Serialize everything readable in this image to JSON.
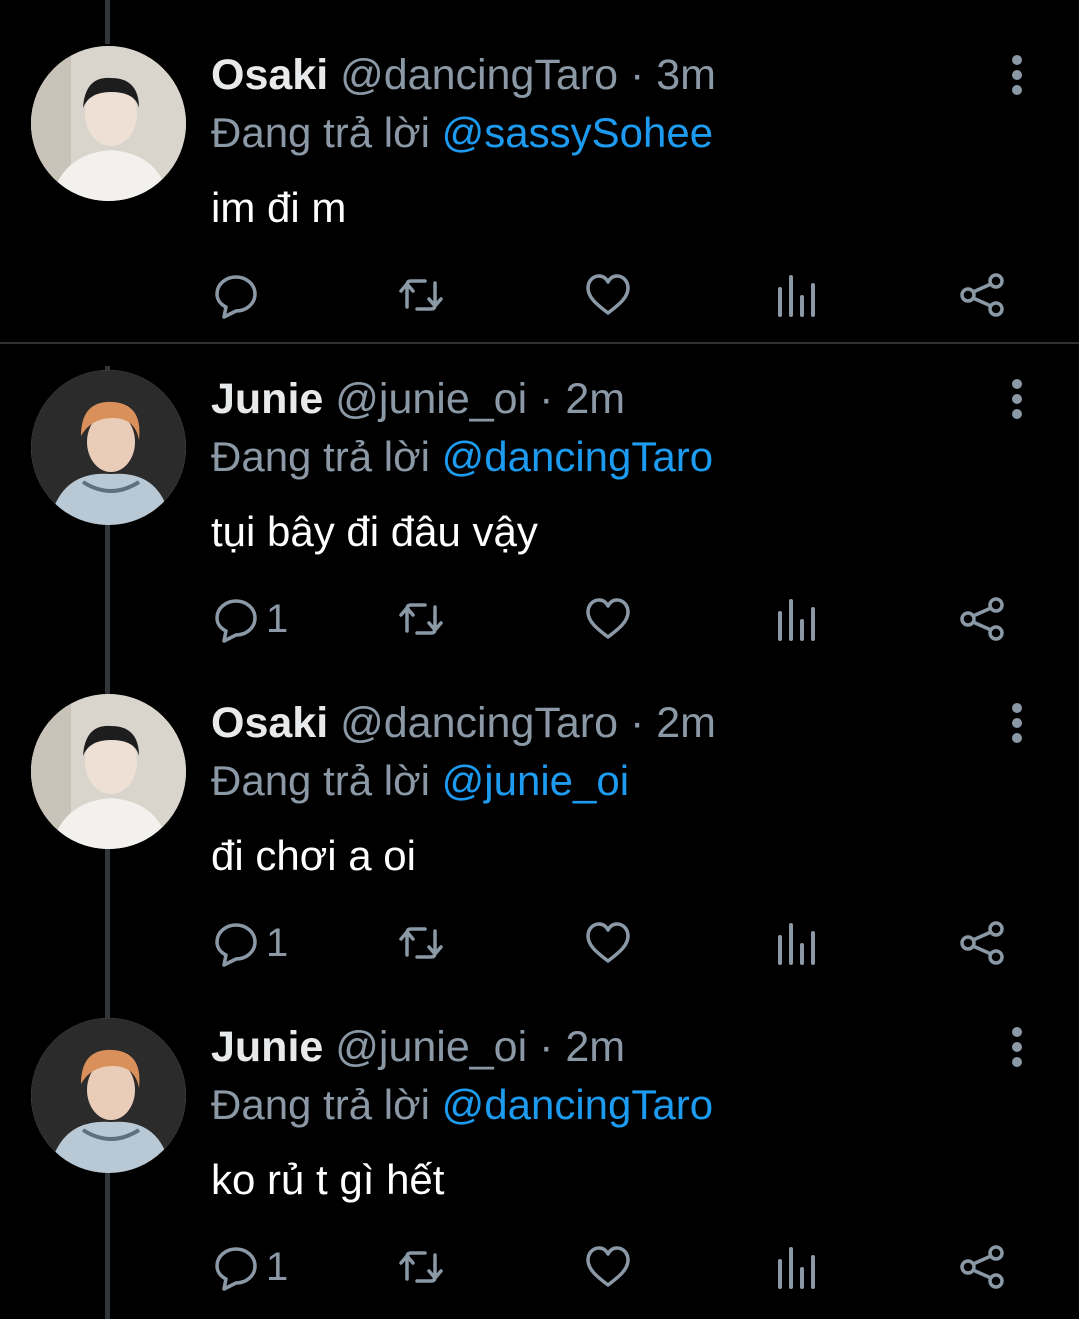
{
  "tweets": [
    {
      "name": "Osaki",
      "handle": "@dancingTaro",
      "time": "3m",
      "reply_prefix": "Đang trả lời",
      "reply_to": "@sassySohee",
      "text": "im đi m",
      "reply_count": ""
    },
    {
      "name": "Junie",
      "handle": "@junie_oi",
      "time": "2m",
      "reply_prefix": "Đang trả lời",
      "reply_to": "@dancingTaro",
      "text": "tụi bây đi đâu vậy",
      "reply_count": "1"
    },
    {
      "name": "Osaki",
      "handle": "@dancingTaro",
      "time": "2m",
      "reply_prefix": "Đang trả lời",
      "reply_to": "@junie_oi",
      "text": "đi chơi a oi",
      "reply_count": "1"
    },
    {
      "name": "Junie",
      "handle": "@junie_oi",
      "time": "2m",
      "reply_prefix": "Đang trả lời",
      "reply_to": "@dancingTaro",
      "text": "ko rủ t gì hết",
      "reply_count": "1"
    }
  ],
  "meta_separator": "·",
  "icons": {
    "reply": "reply-icon",
    "retweet": "retweet-icon",
    "like": "heart-icon",
    "views": "views-icon",
    "share": "share-icon",
    "more": "more-vertical-icon"
  },
  "colors": {
    "background": "#000000",
    "text": "#e7e9ea",
    "secondary": "#8b98a5",
    "mention": "#1d9bf0"
  }
}
